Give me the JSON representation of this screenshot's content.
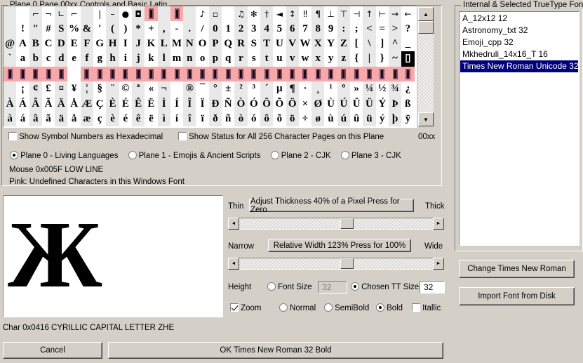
{
  "window": {
    "plane_header": "Plane 0  Page 00xx   Controls and Basic Latin",
    "background": "#d4d0c8",
    "selection_color": "#00007b",
    "pink_color": "#f7a8a8"
  },
  "char_grid": {
    "page_label": "00xx",
    "columns": 32,
    "rows": [
      {
        "type": "control",
        "cells": [
          "",
          "",
          "⌐",
          "¬",
          "∟",
          "⌐",
          "",
          "|",
          "–",
          "●",
          "◘",
          "PINK",
          "",
          "PINK",
          "",
          "♪",
          "▫",
          "",
          "♫",
          "✻",
          "†",
          "◄",
          "↕",
          "‼",
          "¶",
          "⊥",
          "⊤",
          "⊣",
          "↑",
          "⊢",
          "→",
          "←"
        ]
      },
      {
        "type": "ascii",
        "cells": [
          " ",
          "!",
          "\"",
          "#",
          "S",
          "%",
          "&",
          "'",
          "(",
          ")",
          "*",
          "+",
          ",",
          "-",
          ".",
          "/",
          "0",
          "1",
          "2",
          "3",
          "4",
          "5",
          "6",
          "7",
          "8",
          "9",
          ":",
          ";",
          "<",
          "=",
          ">",
          "?"
        ]
      },
      {
        "type": "ascii",
        "cells": [
          "@",
          "A",
          "B",
          "C",
          "D",
          "E",
          "F",
          "G",
          "H",
          "I",
          "J",
          "K",
          "L",
          "M",
          "N",
          "O",
          "P",
          "Q",
          "R",
          "S",
          "T",
          "U",
          "V",
          "W",
          "X",
          "Y",
          "Z",
          "[",
          "\\",
          "]",
          "^",
          "_"
        ]
      },
      {
        "type": "ascii",
        "cells": [
          "`",
          "a",
          "b",
          "c",
          "d",
          "e",
          "f",
          "g",
          "h",
          "i",
          "j",
          "k",
          "l",
          "m",
          "n",
          "o",
          "p",
          "q",
          "r",
          "s",
          "t",
          "u",
          "v",
          "w",
          "x",
          "y",
          "z",
          "{",
          "|",
          "}",
          "~",
          "▯"
        ]
      },
      {
        "type": "undefined",
        "cells": [
          "PINK",
          "PINK",
          "PINK",
          "PINK",
          "PINK",
          "",
          "PINK",
          "PINK",
          "PINK",
          "PINK",
          "PINK",
          "PINK",
          "PINK",
          "PINK",
          "PINK",
          "PINK",
          "PINK",
          "PINK",
          "PINK",
          "PINK",
          "PINK",
          "PINK",
          "PINK",
          "PINK",
          "PINK",
          "PINK",
          "PINK",
          "PINK",
          "PINK",
          "PINK",
          "PINK",
          "PINK"
        ]
      },
      {
        "type": "latin1",
        "cells": [
          " ",
          "¡",
          "¢",
          "£",
          "¤",
          "¥",
          "¦",
          "§",
          "¨",
          "©",
          "ª",
          "«",
          "¬",
          "­",
          "®",
          "¯",
          "°",
          "±",
          "²",
          "³",
          "´",
          "µ",
          "¶",
          "·",
          "¸",
          "¹",
          "º",
          "»",
          "¼",
          "½",
          "¾",
          "¿"
        ]
      },
      {
        "type": "latin1",
        "cells": [
          "À",
          "Á",
          "Â",
          "Ã",
          "Ä",
          "Å",
          "Æ",
          "Ç",
          "È",
          "É",
          "Ê",
          "Ë",
          "Ì",
          "Í",
          "Î",
          "Ï",
          "Ð",
          "Ñ",
          "Ò",
          "Ó",
          "Ô",
          "Õ",
          "Ö",
          "×",
          "Ø",
          "Ù",
          "Ú",
          "Û",
          "Ü",
          "Ý",
          "Þ",
          "ß"
        ]
      },
      {
        "type": "latin1",
        "cells": [
          "à",
          "á",
          "â",
          "ã",
          "ä",
          "å",
          "æ",
          "ç",
          "è",
          "é",
          "ê",
          "ë",
          "ì",
          "í",
          "î",
          "ï",
          "ð",
          "ñ",
          "ò",
          "ó",
          "ô",
          "õ",
          "ö",
          "÷",
          "ø",
          "ù",
          "ú",
          "û",
          "ü",
          "ý",
          "þ",
          "ÿ"
        ]
      }
    ]
  },
  "options": {
    "hex_checkbox": {
      "label": "Show Symbol Numbers as Hexadecimal",
      "checked": false
    },
    "status_checkbox": {
      "label": "Show Status for All 256 Character Pages on this Plane",
      "checked": false
    },
    "planes": [
      {
        "label": "Plane 0 - Living Languages",
        "selected": true
      },
      {
        "label": "Plane 1 - Emojis & Ancient Scripts",
        "selected": false
      },
      {
        "label": "Plane 2 - CJK",
        "selected": false
      },
      {
        "label": "Plane 3 - CJK",
        "selected": false
      }
    ],
    "mouse_status": "Mouse 0x005F  LOW LINE",
    "pink_legend": "Pink: Undefined Characters in this Windows Font"
  },
  "font_panel": {
    "title": "Internal & Selected TrueType Font",
    "items": [
      {
        "label": "A_12x12 12",
        "selected": false
      },
      {
        "label": "Astronomy_txt 32",
        "selected": false
      },
      {
        "label": "Emoji_cpp 32",
        "selected": false
      },
      {
        "label": "Mkhedruli_14x16_T 16",
        "selected": false
      },
      {
        "label": "Times New Roman Unicode 32",
        "selected": true
      }
    ],
    "change_button": "Change  Times New Roman",
    "import_button": "Import Font from Disk"
  },
  "preview": {
    "glyph": "Ж"
  },
  "thickness": {
    "left_label": "Thin",
    "right_label": "Thick",
    "button": "Adjust Thickness 40% of a Pixel  Press for Zero",
    "slider_percent": 52
  },
  "width": {
    "left_label": "Narrow",
    "right_label": "Wide",
    "button": "Relative Width 123%  Press for 100%",
    "slider_percent": 52
  },
  "size": {
    "height_label": "Height",
    "font_size_radio": {
      "label": "Font Size",
      "selected": false
    },
    "font_size_value": "32",
    "chosen_tt_radio": {
      "label": "Chosen TT Size",
      "selected": true
    },
    "chosen_tt_value": "32"
  },
  "style": {
    "zoom_checkbox": {
      "label": "Zoom",
      "checked": true
    },
    "weights": [
      {
        "label": "Normal",
        "selected": false
      },
      {
        "label": "SemiBold",
        "selected": false
      },
      {
        "label": "Bold",
        "selected": true
      }
    ],
    "italic_checkbox": {
      "label": "Itallic",
      "checked": false
    }
  },
  "status_bar": {
    "char_info": "Char 0x0416  CYRILLIC CAPITAL LETTER ZHE",
    "cancel_button": "Cancel",
    "ok_button": "OK    Times New Roman 32 Bold"
  }
}
